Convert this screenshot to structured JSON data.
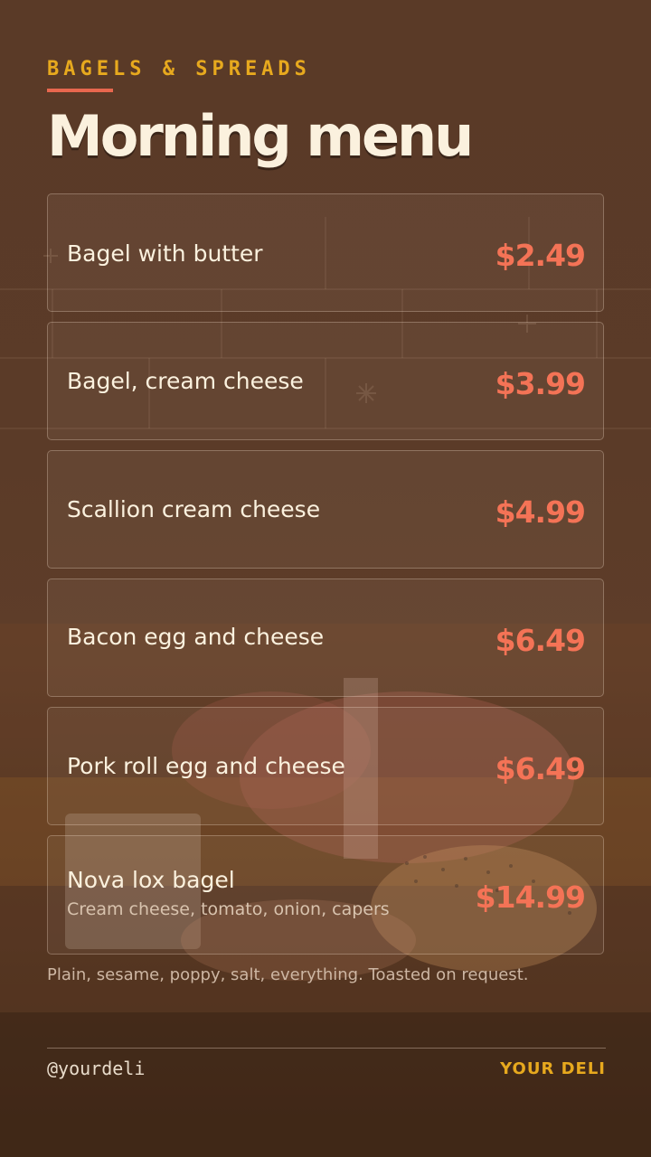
{
  "header": {
    "eyebrow": "BAGELS & SPREADS",
    "title": "Morning menu"
  },
  "menu": {
    "items": [
      {
        "name": "Bagel with butter",
        "price": "$2.49",
        "description": ""
      },
      {
        "name": "Bagel, cream cheese",
        "price": "$3.99",
        "description": ""
      },
      {
        "name": "Scallion cream cheese",
        "price": "$4.99",
        "description": ""
      },
      {
        "name": "Bacon egg and cheese",
        "price": "$6.49",
        "description": ""
      },
      {
        "name": "Pork roll egg and cheese",
        "price": "$6.49",
        "description": ""
      },
      {
        "name": "Nova lox bagel",
        "price": "$14.99",
        "description": "Cream cheese, tomato, onion, capers"
      }
    ],
    "footnote": "Plain, sesame, poppy, salt, everything. Toasted on request."
  },
  "footer": {
    "handle": "@yourdeli",
    "brand": "YOUR DELI"
  },
  "colors": {
    "accent_yellow": "#e7a91e",
    "accent_coral": "#f47356",
    "cream": "#fbf1de",
    "background": "#5a3a27"
  }
}
